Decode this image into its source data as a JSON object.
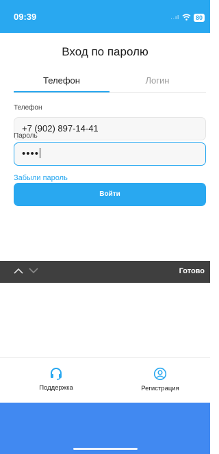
{
  "status_bar": {
    "time": "09:39",
    "signal": "..ıl",
    "wifi_icon": "wifi-icon",
    "battery": "80"
  },
  "title": "Вход по паролю",
  "tabs": [
    {
      "label": "Телефон",
      "active": true
    },
    {
      "label": "Логин",
      "active": false
    }
  ],
  "phone": {
    "label": "Телефон",
    "value": "+7 (902) 897-14-41"
  },
  "password": {
    "label": "Пароль",
    "value": "••••"
  },
  "forgot_link": "Забыли пароль",
  "login_button": "Войти",
  "keyboard_toolbar": {
    "up_icon": "chevron-up-icon",
    "down_icon": "chevron-down-icon",
    "done": "Готово"
  },
  "bottom_nav": [
    {
      "label": "Поддержка",
      "icon": "headset-icon"
    },
    {
      "label": "Регистрация",
      "icon": "user-circle-icon"
    }
  ],
  "colors": {
    "accent": "#29a8f0",
    "footer": "#4189f1",
    "toolbar": "#3f3f3f"
  }
}
